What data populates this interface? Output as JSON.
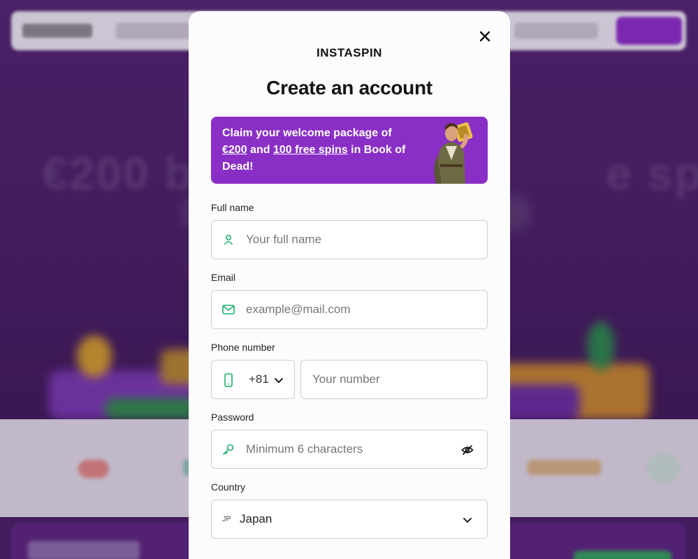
{
  "modal": {
    "logo": "INSTASPIN",
    "title": "Create an account",
    "promo": {
      "line1": "Claim your welcome package of",
      "amount": "€200",
      "and": "and",
      "spins": "100 free spins",
      "in": "in Book of",
      "end": "Dead!"
    },
    "fields": {
      "full_name": {
        "label": "Full name",
        "placeholder": "Your full name"
      },
      "email": {
        "label": "Email",
        "placeholder": "example@mail.com"
      },
      "phone": {
        "label": "Phone number",
        "code": "+81",
        "placeholder": "Your number"
      },
      "password": {
        "label": "Password",
        "placeholder": "Minimum 6 characters"
      },
      "country": {
        "label": "Country",
        "flag": "JP",
        "value": "Japan"
      }
    }
  },
  "icons": {
    "close": "close-icon",
    "user": "user-icon",
    "mail": "mail-icon",
    "phone": "phone-icon",
    "key": "key-icon",
    "eye_off": "eye-off-icon",
    "chevron": "chevron-down-icon"
  },
  "colors": {
    "brand_purple": "#8a2fc6",
    "icon_green": "#1fae6e",
    "background_purple": "#4a2266"
  }
}
